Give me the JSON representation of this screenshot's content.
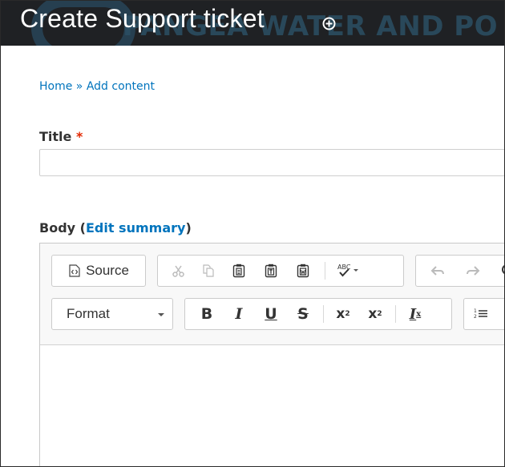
{
  "header": {
    "title": "Create Support ticket",
    "watermark": "PANGEA WATER AND PO"
  },
  "breadcrumb": {
    "home": "Home",
    "separator": "»",
    "current": "Add content"
  },
  "title_field": {
    "label": "Title",
    "required_marker": "*",
    "value": ""
  },
  "body_field": {
    "label": "Body",
    "paren_open": "(",
    "summary_link": "Edit summary",
    "paren_close": ")"
  },
  "toolbar": {
    "source_label": "Source",
    "format_label": "Format",
    "bold_label": "B",
    "italic_label": "I",
    "underline_label": "U",
    "strike_label": "S",
    "subscript_label": "x",
    "subscript_sub": "2",
    "superscript_label": "x",
    "superscript_sup": "2",
    "remove_format_label": "I",
    "remove_format_sub": "x",
    "spellcheck_label": "ABC"
  },
  "colors": {
    "header_bg": "#1f2124",
    "link": "#0074bd",
    "required": "#e32700"
  }
}
